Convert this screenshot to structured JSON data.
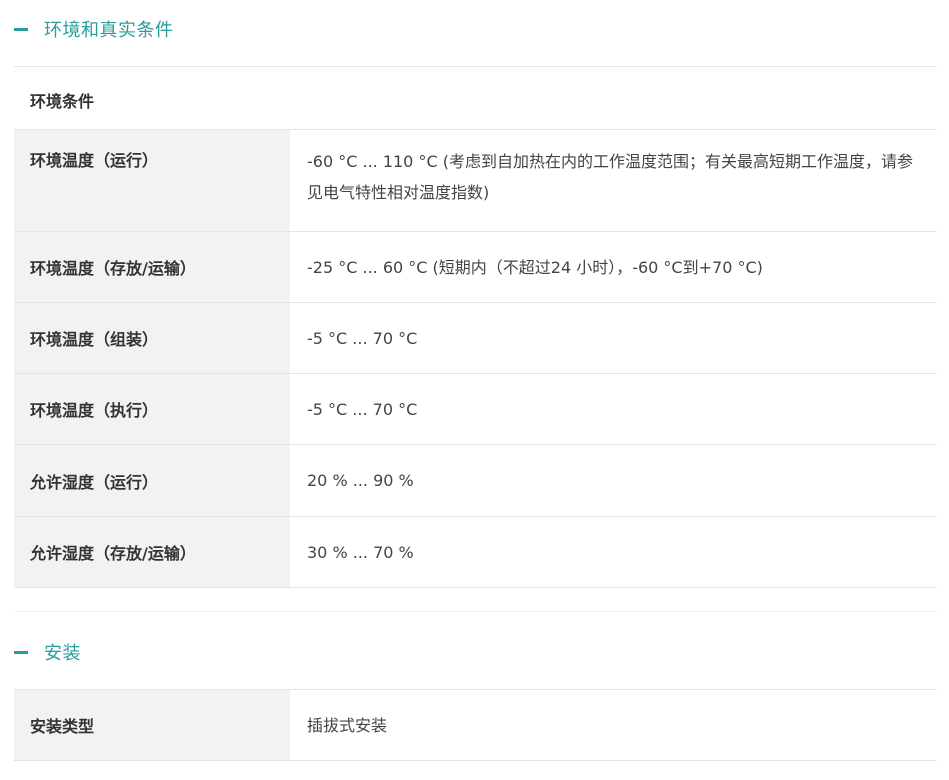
{
  "sections": [
    {
      "title": "环境和真实条件",
      "group_title": "环境条件",
      "rows": [
        {
          "label": "环境温度（运行）",
          "value": "-60 °C ... 110 °C (考虑到自加热在内的工作温度范围；有关最高短期工作温度，请参见电气特性相对温度指数)"
        },
        {
          "label": "环境温度（存放/运输）",
          "value": "-25 °C ... 60 °C (短期内（不超过24  小时），-60 °C到+70 °C)"
        },
        {
          "label": "环境温度（组装）",
          "value": "-5 °C ... 70 °C"
        },
        {
          "label": "环境温度（执行）",
          "value": "-5 °C ... 70 °C"
        },
        {
          "label": "允许湿度（运行）",
          "value": "20 % ... 90 %"
        },
        {
          "label": "允许湿度（存放/运输）",
          "value": "30 % ... 70 %"
        }
      ]
    },
    {
      "title": "安装",
      "rows": [
        {
          "label": "安装类型",
          "value": "插拔式安装"
        }
      ]
    }
  ],
  "colors": {
    "accent": "#2a9c9c",
    "label_bg": "#f2f2f2",
    "divider": "#e6e6e6"
  }
}
